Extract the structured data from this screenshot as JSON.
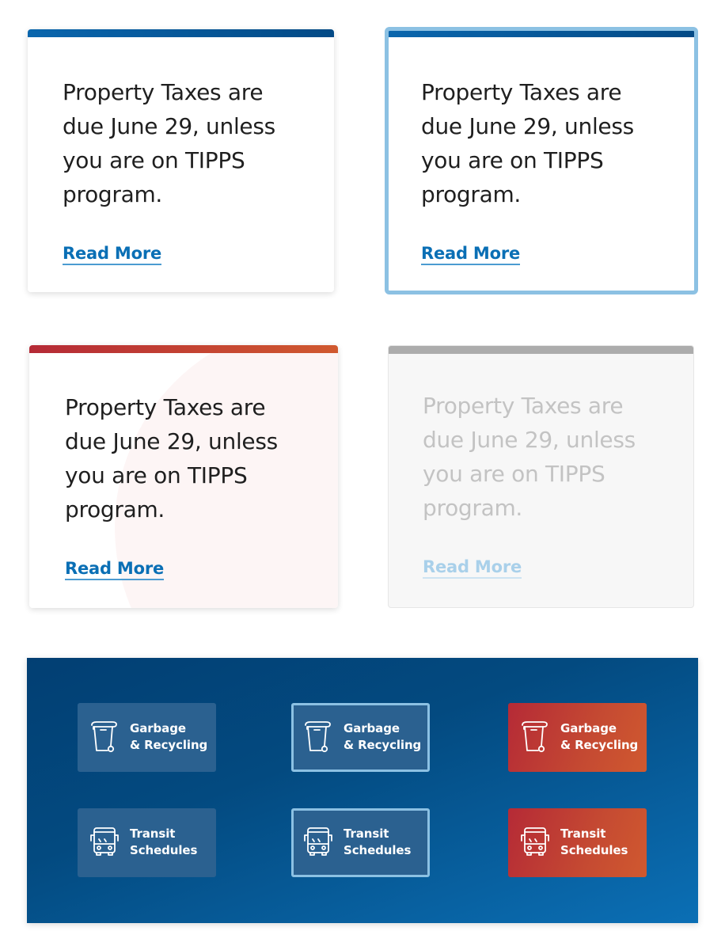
{
  "cards": [
    {
      "state": "default",
      "text": "Property Taxes are due June 29, unless you are on TIPPS program.",
      "link_label": "Read More",
      "accent": "#0a66ad"
    },
    {
      "state": "focus",
      "text": "Property Taxes are due June 29, unless you are on TIPPS program.",
      "link_label": "Read More",
      "accent": "#0a66ad",
      "focus_ring": "#8cc1e3"
    },
    {
      "state": "hover",
      "text": "Property Taxes are due June 29, unless you are on TIPPS program.",
      "link_label": "Read More",
      "accent": "#c0392b"
    },
    {
      "state": "disabled",
      "text": "Property Taxes are due June 29, unless you are on TIPPS program.",
      "link_label": "Read More",
      "accent": "#acacac"
    }
  ],
  "tiles": {
    "garbage": {
      "icon": "trash-bin-icon",
      "line1": "Garbage",
      "line2": "& Recycling"
    },
    "transit": {
      "icon": "bus-icon",
      "line1": "Transit",
      "line2": "Schedules"
    },
    "states": [
      "default",
      "focus",
      "hover"
    ]
  },
  "colors": {
    "link": "#0a6fb5",
    "panel_bg": "#034a80",
    "tile_default": "#2b6190",
    "tile_hover": "#c54a32",
    "focus_ring": "#8cc1e3"
  }
}
